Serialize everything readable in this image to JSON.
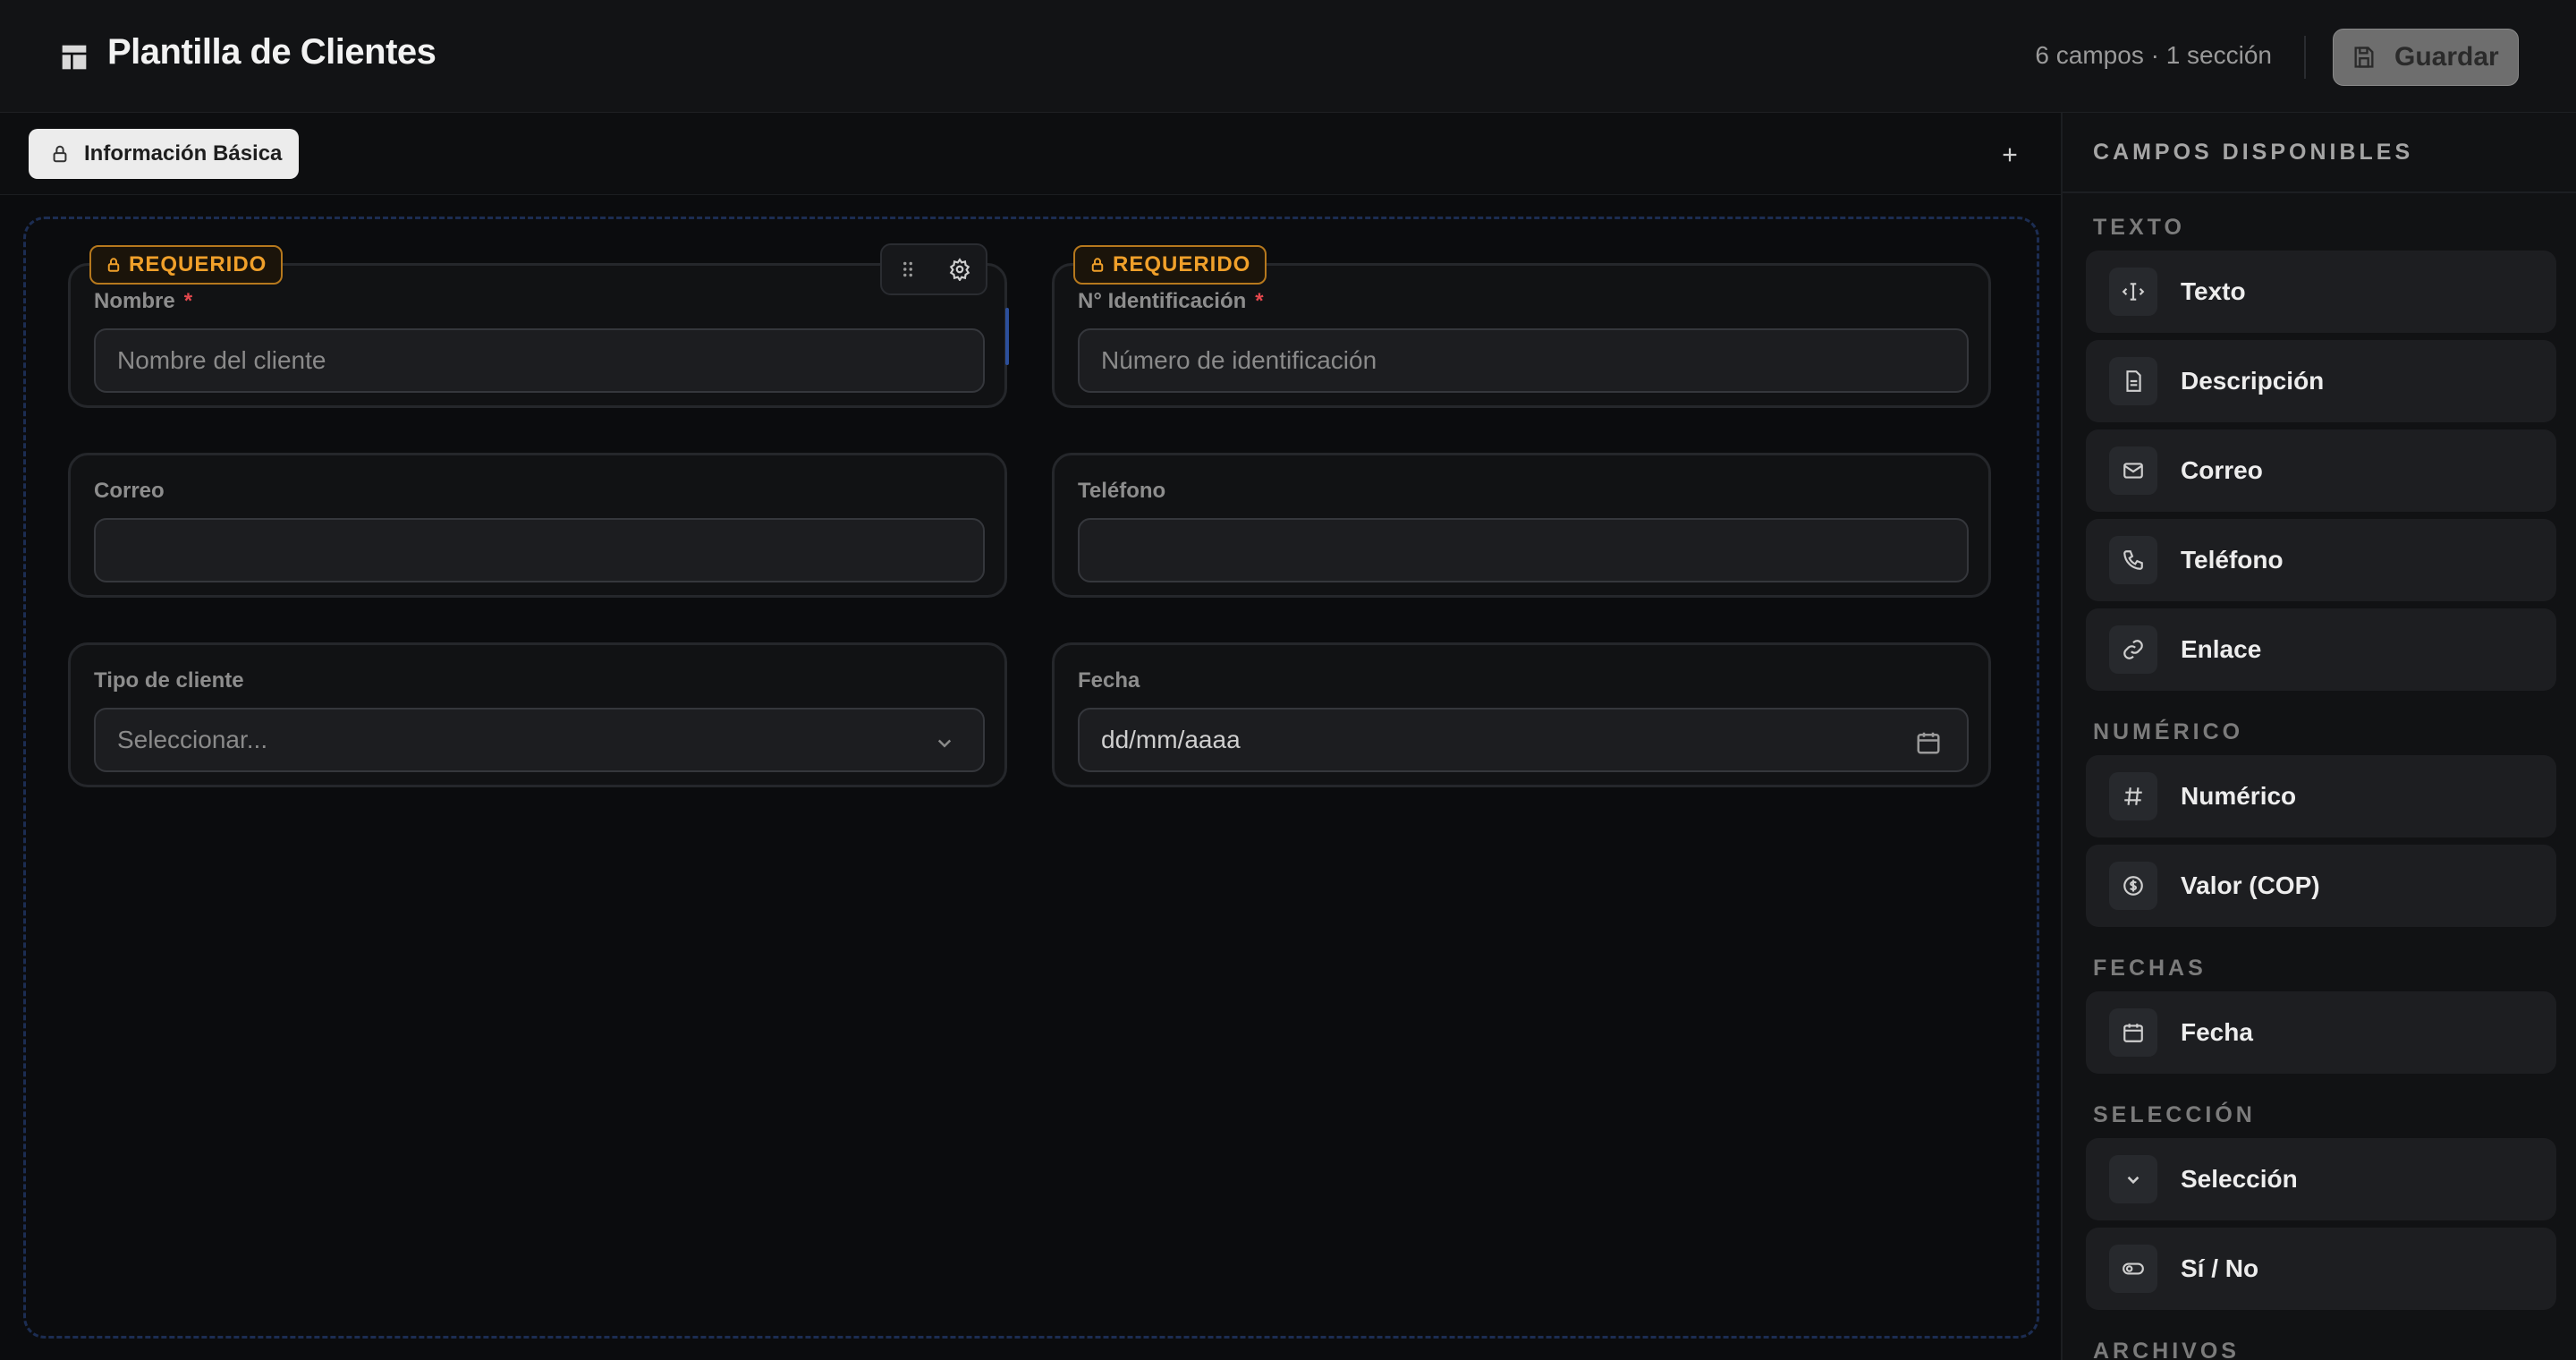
{
  "header": {
    "title": "Plantilla de Clientes",
    "meta": "6 campos · 1 sección",
    "save_label": "Guardar"
  },
  "sections": {
    "active_tab": "Información Básica"
  },
  "form": {
    "required_badge": "REQUERIDO",
    "fields": [
      {
        "label": "Nombre",
        "required": true,
        "placeholder": "Nombre del cliente",
        "type": "text"
      },
      {
        "label": "N° Identificación",
        "required": true,
        "placeholder": "Número de identificación",
        "type": "text"
      },
      {
        "label": "Correo",
        "required": false,
        "placeholder": "",
        "type": "email"
      },
      {
        "label": "Teléfono",
        "required": false,
        "placeholder": "",
        "type": "phone"
      },
      {
        "label": "Tipo de cliente",
        "required": false,
        "placeholder": "Seleccionar...",
        "type": "select"
      },
      {
        "label": "Fecha",
        "required": false,
        "placeholder": "dd/mm/aaaa",
        "type": "date"
      }
    ]
  },
  "panel": {
    "title": "CAMPOS DISPONIBLES",
    "groups": [
      {
        "title": "TEXTO",
        "items": [
          {
            "label": "Texto",
            "icon": "text-cursor-icon"
          },
          {
            "label": "Descripción",
            "icon": "document-icon"
          },
          {
            "label": "Correo",
            "icon": "mail-icon"
          },
          {
            "label": "Teléfono",
            "icon": "phone-icon"
          },
          {
            "label": "Enlace",
            "icon": "link-icon"
          }
        ]
      },
      {
        "title": "NUMÉRICO",
        "items": [
          {
            "label": "Numérico",
            "icon": "hash-icon"
          },
          {
            "label": "Valor (COP)",
            "icon": "dollar-circle-icon"
          }
        ]
      },
      {
        "title": "FECHAS",
        "items": [
          {
            "label": "Fecha",
            "icon": "calendar-icon"
          }
        ]
      },
      {
        "title": "SELECCIÓN",
        "items": [
          {
            "label": "Selección",
            "icon": "chevron-down-icon"
          },
          {
            "label": "Sí / No",
            "icon": "toggle-icon"
          }
        ]
      },
      {
        "title": "ARCHIVOS",
        "items": []
      }
    ]
  },
  "colors": {
    "accent_required": "#f0a02a",
    "required_star": "#e5484d",
    "canvas_border": "#1c2d52",
    "drop_indicator": "#2c4f9b"
  }
}
